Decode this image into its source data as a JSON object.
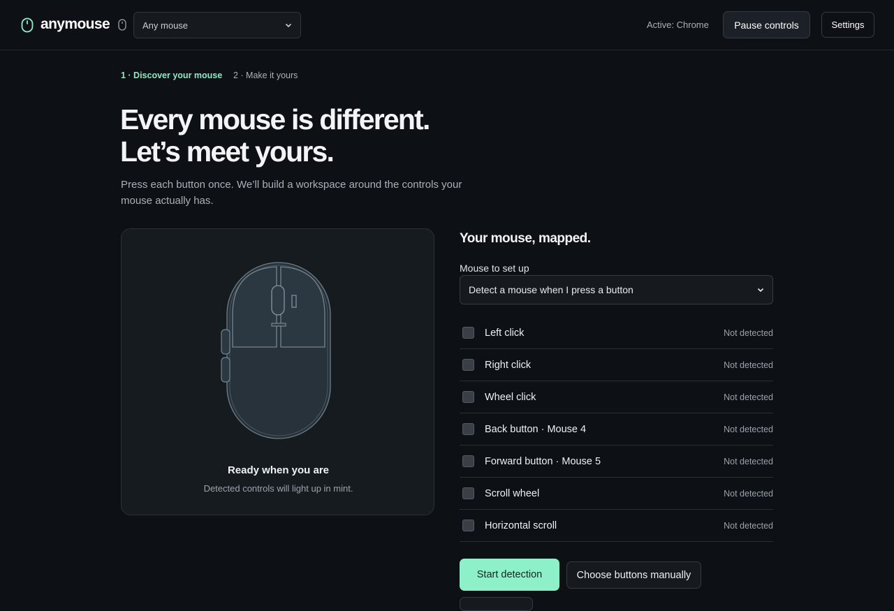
{
  "header": {
    "brand": "anymouse",
    "device_select": "Any mouse",
    "active_label": "Active: Chrome",
    "pause_label": "Pause controls",
    "settings_label": "Settings"
  },
  "steps": [
    {
      "label": "1 · Discover your mouse",
      "state": "active"
    },
    {
      "label": "2 · Make it yours",
      "state": "inactive"
    }
  ],
  "hero": {
    "line1": "Every mouse is different.",
    "line2": "Let’s meet yours.",
    "subtitle": "Press each button once. We’ll build a workspace around the controls your mouse actually has."
  },
  "preview": {
    "title": "Ready when you are",
    "subtitle": "Detected controls will light up in mint."
  },
  "mapping": {
    "title": "Your mouse, mapped.",
    "field_label": "Mouse to set up",
    "select_value": "Detect a mouse when I press a button",
    "controls": [
      {
        "label": "Left click",
        "status": "Not detected",
        "checked": false
      },
      {
        "label": "Right click",
        "status": "Not detected",
        "checked": false
      },
      {
        "label": "Wheel click",
        "status": "Not detected",
        "checked": false
      },
      {
        "label": "Back button · Mouse 4",
        "status": "Not detected",
        "checked": false
      },
      {
        "label": "Forward button · Mouse 5",
        "status": "Not detected",
        "checked": false
      },
      {
        "label": "Scroll wheel",
        "status": "Not detected",
        "checked": false
      },
      {
        "label": "Horizontal scroll",
        "status": "Not detected",
        "checked": false
      }
    ]
  },
  "actions": {
    "start_label": "Start detection",
    "manual_label": "Choose buttons manually"
  },
  "colors": {
    "background": "#0d1014",
    "accent_mint": "#8ef0c8",
    "card": "#161b20"
  }
}
